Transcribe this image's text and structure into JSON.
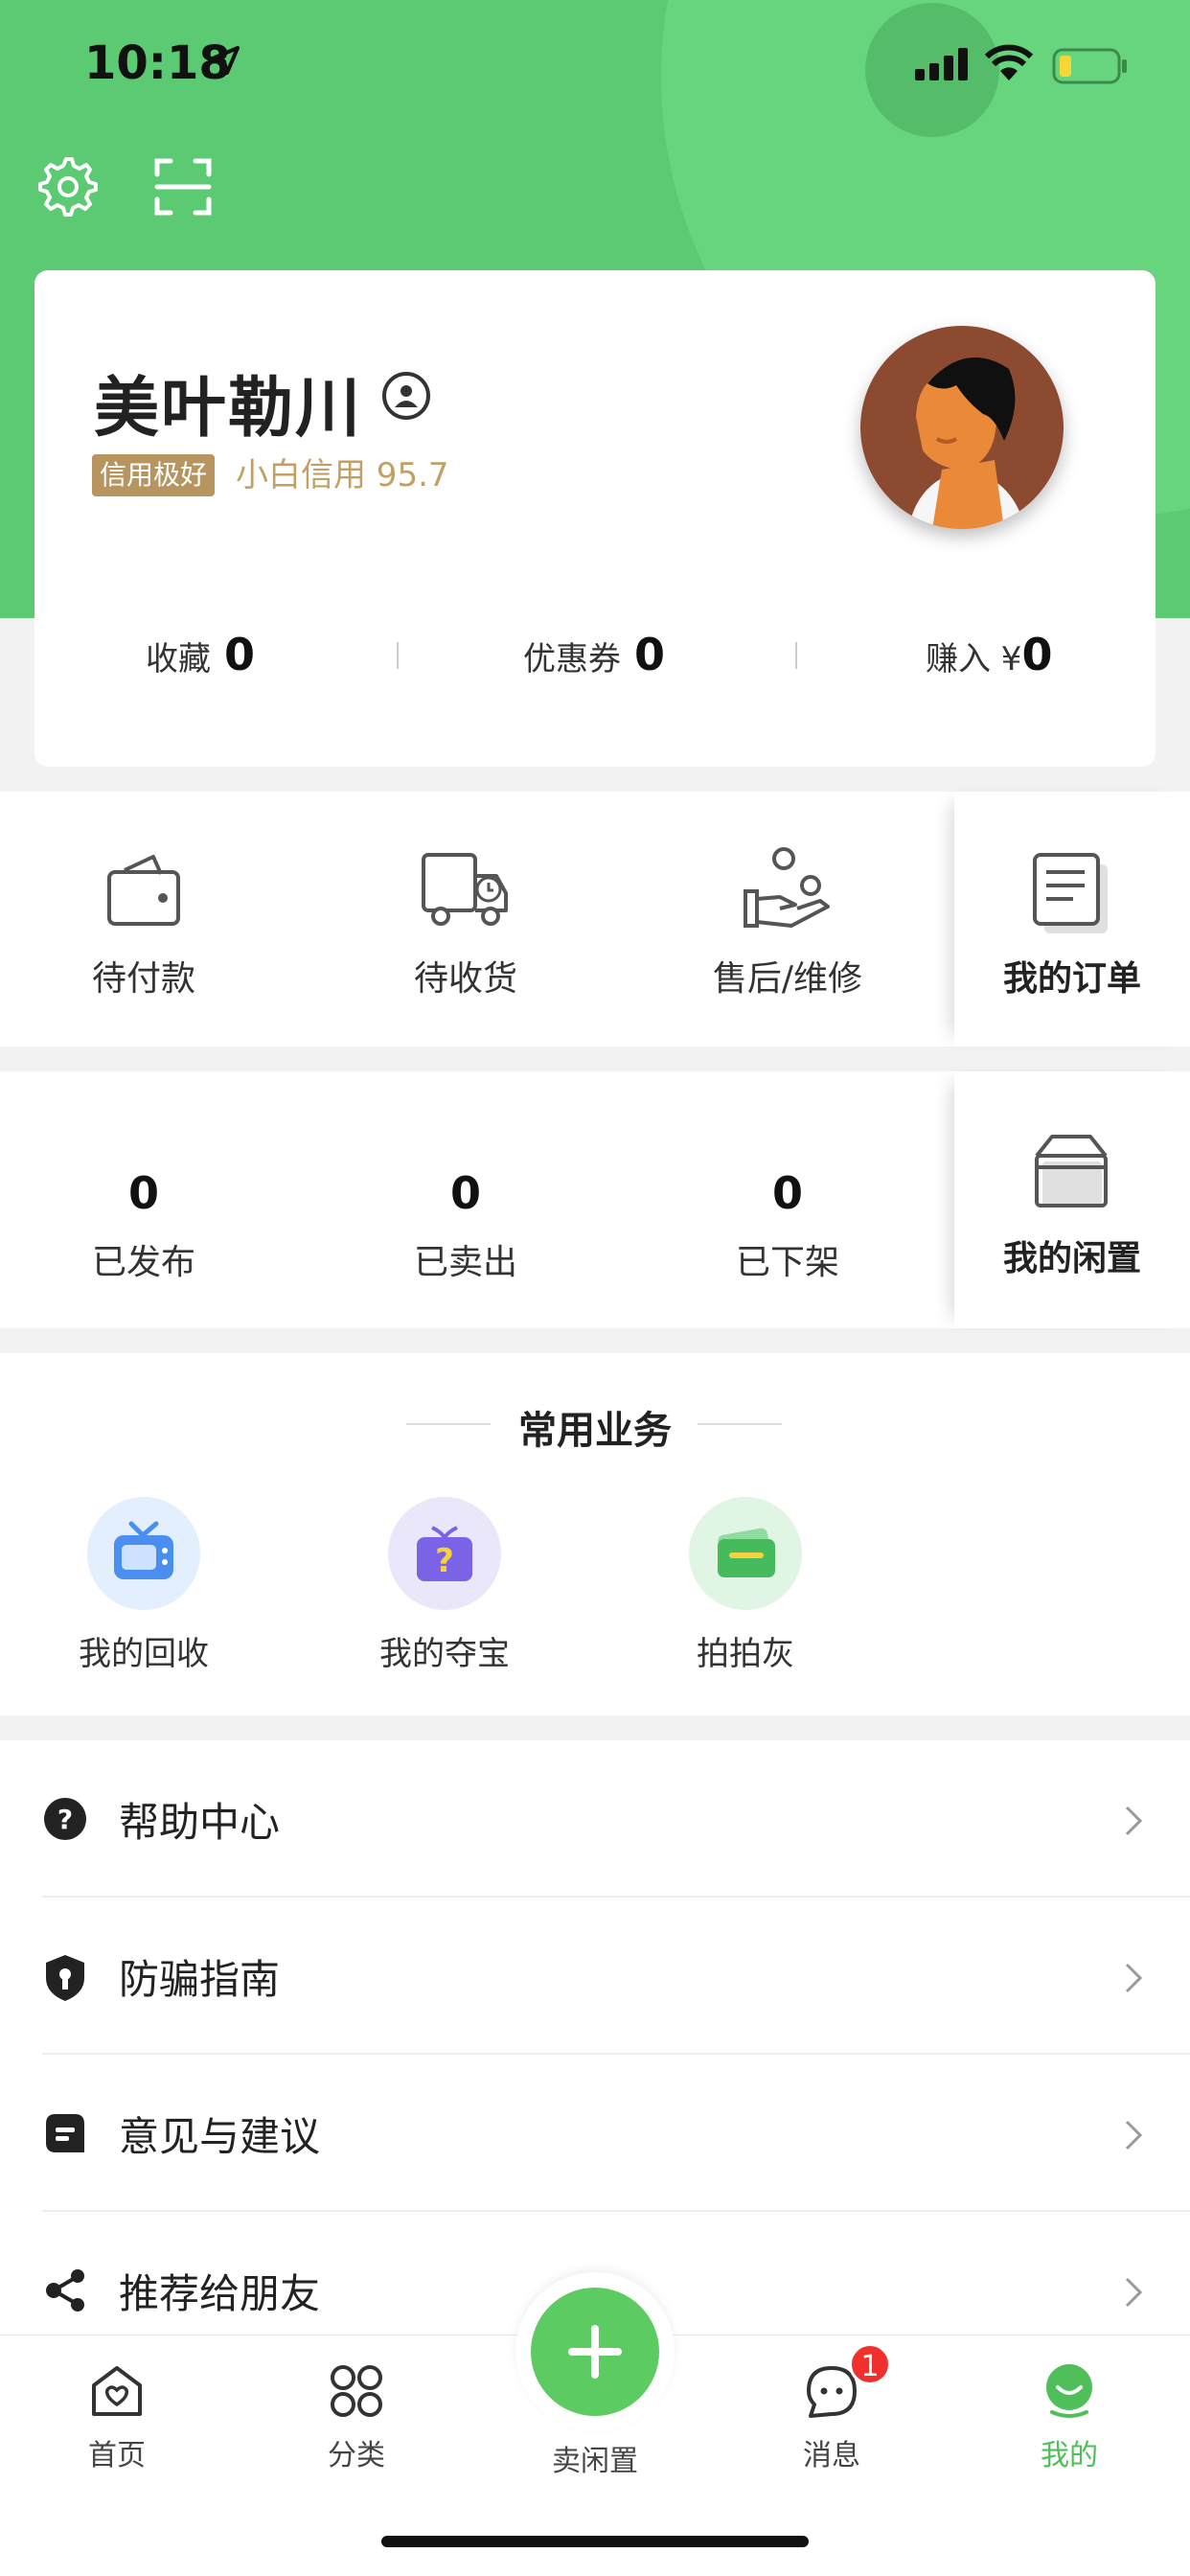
{
  "status_bar": {
    "time": "10:18"
  },
  "profile": {
    "name": "美叶勒川",
    "credit_badge": "信用极好",
    "credit_score": "小白信用 95.7",
    "stats": [
      {
        "label": "收藏",
        "value": "0"
      },
      {
        "label": "优惠券",
        "value": "0"
      },
      {
        "label": "赚入 ¥",
        "value": "0"
      }
    ]
  },
  "orders": {
    "items": [
      {
        "label": "待付款",
        "icon": "wallet-icon"
      },
      {
        "label": "待收货",
        "icon": "truck-icon"
      },
      {
        "label": "售后/维修",
        "icon": "hand-coin-icon"
      }
    ],
    "side_label": "我的订单"
  },
  "idle": {
    "items": [
      {
        "label": "已发布",
        "value": "0"
      },
      {
        "label": "已卖出",
        "value": "0"
      },
      {
        "label": "已下架",
        "value": "0"
      }
    ],
    "side_label": "我的闲置"
  },
  "services": {
    "title": "常用业务",
    "items": [
      {
        "label": "我的回收",
        "icon": "tv-icon",
        "color": "#4a8ff0",
        "bg": "#e3effc"
      },
      {
        "label": "我的夺宝",
        "icon": "gift-question-icon",
        "color": "#7b63e8",
        "bg": "#ebe7fb"
      },
      {
        "label": "拍拍灰",
        "icon": "card-icon",
        "color": "#45bb5e",
        "bg": "#e1f5e5"
      }
    ]
  },
  "menu": [
    {
      "label": "帮助中心",
      "icon": "question-icon"
    },
    {
      "label": "防骗指南",
      "icon": "shield-icon"
    },
    {
      "label": "意见与建议",
      "icon": "feedback-icon"
    },
    {
      "label": "推荐给朋友",
      "icon": "share-icon"
    }
  ],
  "tabbar": {
    "items": [
      {
        "label": "首页",
        "icon": "home-heart-icon"
      },
      {
        "label": "分类",
        "icon": "grid-circles-icon"
      },
      {
        "label": "卖闲置",
        "icon": "plus-icon"
      },
      {
        "label": "消息",
        "icon": "chat-icon"
      },
      {
        "label": "我的",
        "icon": "smile-icon"
      }
    ],
    "message_badge": "1",
    "active_color": "#4fbf5a"
  },
  "colors": {
    "brand_green": "#5cca73",
    "credit_gold": "#b69560"
  }
}
